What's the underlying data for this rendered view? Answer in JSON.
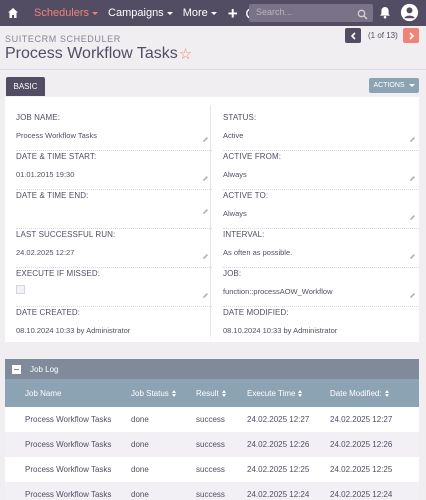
{
  "nav": {
    "items": [
      {
        "label": "Schedulers",
        "active": true
      },
      {
        "label": "Campaigns",
        "active": false
      },
      {
        "label": "More",
        "active": false
      }
    ],
    "search_placeholder": "Search..."
  },
  "header": {
    "module_label": "SUITECRM SCHEDULER",
    "title": "Process Workflow Tasks",
    "pager_text": "(1 of 13)"
  },
  "tabs": [
    {
      "label": "BASIC"
    }
  ],
  "actions_label": "ACTIONS",
  "fields": {
    "job_name": {
      "label": "JOB NAME:",
      "value": "Process Workflow Tasks"
    },
    "status": {
      "label": "STATUS:",
      "value": "Active"
    },
    "date_time_start": {
      "label": "DATE & TIME START:",
      "value": "01.01.2015 19:30"
    },
    "active_from": {
      "label": "ACTIVE FROM:",
      "value": "Always"
    },
    "date_time_end": {
      "label": "DATE & TIME END:",
      "value": ""
    },
    "active_to": {
      "label": "ACTIVE TO:",
      "value": "Always"
    },
    "last_successful_run": {
      "label": "LAST SUCCESSFUL RUN:",
      "value": "24.02.2025 12:27"
    },
    "interval": {
      "label": "INTERVAL:",
      "value": "As often as possible."
    },
    "execute_if_missed": {
      "label": "EXECUTE IF MISSED:",
      "checked": false
    },
    "job": {
      "label": "JOB:",
      "value": "function::processAOW_Workflow"
    },
    "date_created": {
      "label": "DATE CREATED:",
      "value": "08.10.2024 10:33 by Administrator"
    },
    "date_modified": {
      "label": "DATE MODIFIED:",
      "value": "08.10.2024 10:33 by Administrator"
    }
  },
  "job_log": {
    "title": "Job Log",
    "columns": [
      "Job Name",
      "Job Status",
      "Result",
      "Execute Time",
      "Date Modified:"
    ],
    "rows": [
      {
        "job_name": "Process Workflow Tasks",
        "job_status": "done",
        "result": "success",
        "execute_time": "24.02.2025 12:27",
        "date_modified": "24.02.2025 12:27"
      },
      {
        "job_name": "Process Workflow Tasks",
        "job_status": "done",
        "result": "success",
        "execute_time": "24.02.2025 12:26",
        "date_modified": "24.02.2025 12:26"
      },
      {
        "job_name": "Process Workflow Tasks",
        "job_status": "done",
        "result": "success",
        "execute_time": "24.02.2025 12:25",
        "date_modified": "24.02.2025 12:25"
      },
      {
        "job_name": "Process Workflow Tasks",
        "job_status": "done",
        "result": "success",
        "execute_time": "24.02.2025 12:24",
        "date_modified": "24.02.2025 12:24"
      }
    ]
  },
  "icons": [
    "home-icon",
    "plus-icon",
    "history-icon",
    "search-icon",
    "bell-icon",
    "user-avatar-icon",
    "pencil-icon",
    "chevron-left-icon",
    "chevron-right-icon",
    "star-icon"
  ],
  "colors": {
    "nav_bg": "#534d64",
    "accent": "#f08377",
    "subpanel_header": "#8ca3b4"
  }
}
